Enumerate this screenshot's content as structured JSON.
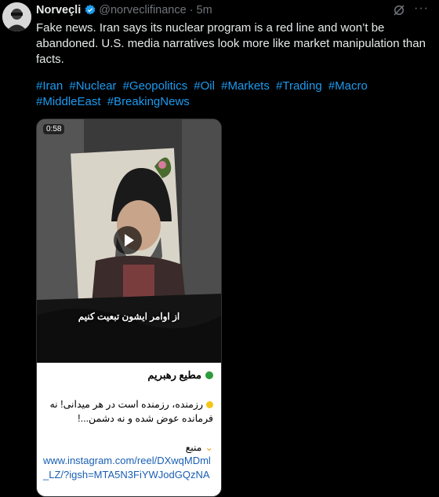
{
  "author": {
    "name": "Norveçli",
    "handle": "@norveclifinance",
    "time": "5m",
    "separator": "·"
  },
  "post": {
    "text": "Fake news. Iran says its nuclear program is a red line and won’t be abandoned. U.S. media narratives look more like market manipulation than facts.",
    "hashtags": [
      "#Iran",
      "#Nuclear",
      "#Geopolitics",
      "#Oil",
      "#Markets",
      "#Trading",
      "#Macro",
      "#MiddleEast",
      "#BreakingNews"
    ]
  },
  "media": {
    "duration": "0:58",
    "video_caption": "از اوامر ایشون تبعیت کنیم",
    "channel_name": "مطیع رهبریم",
    "body_text": "رزمنده، رزمنده است در هر میدانی! نه فرمانده عوض شده و نه دشمن...!",
    "source_label": "منبع",
    "link_text": "www.instagram.com/reel/DXwqMDml_LZ/?igsh=MTA5N3FiYWJodGQzNA"
  },
  "icons": {
    "verified": "verified-badge-icon",
    "grok": "grok-icon",
    "more": "more-icon",
    "play": "play-icon"
  },
  "colors": {
    "background": "#000000",
    "link": "#1d9bf0",
    "muted": "#71767b",
    "text": "#e7e9ea"
  }
}
